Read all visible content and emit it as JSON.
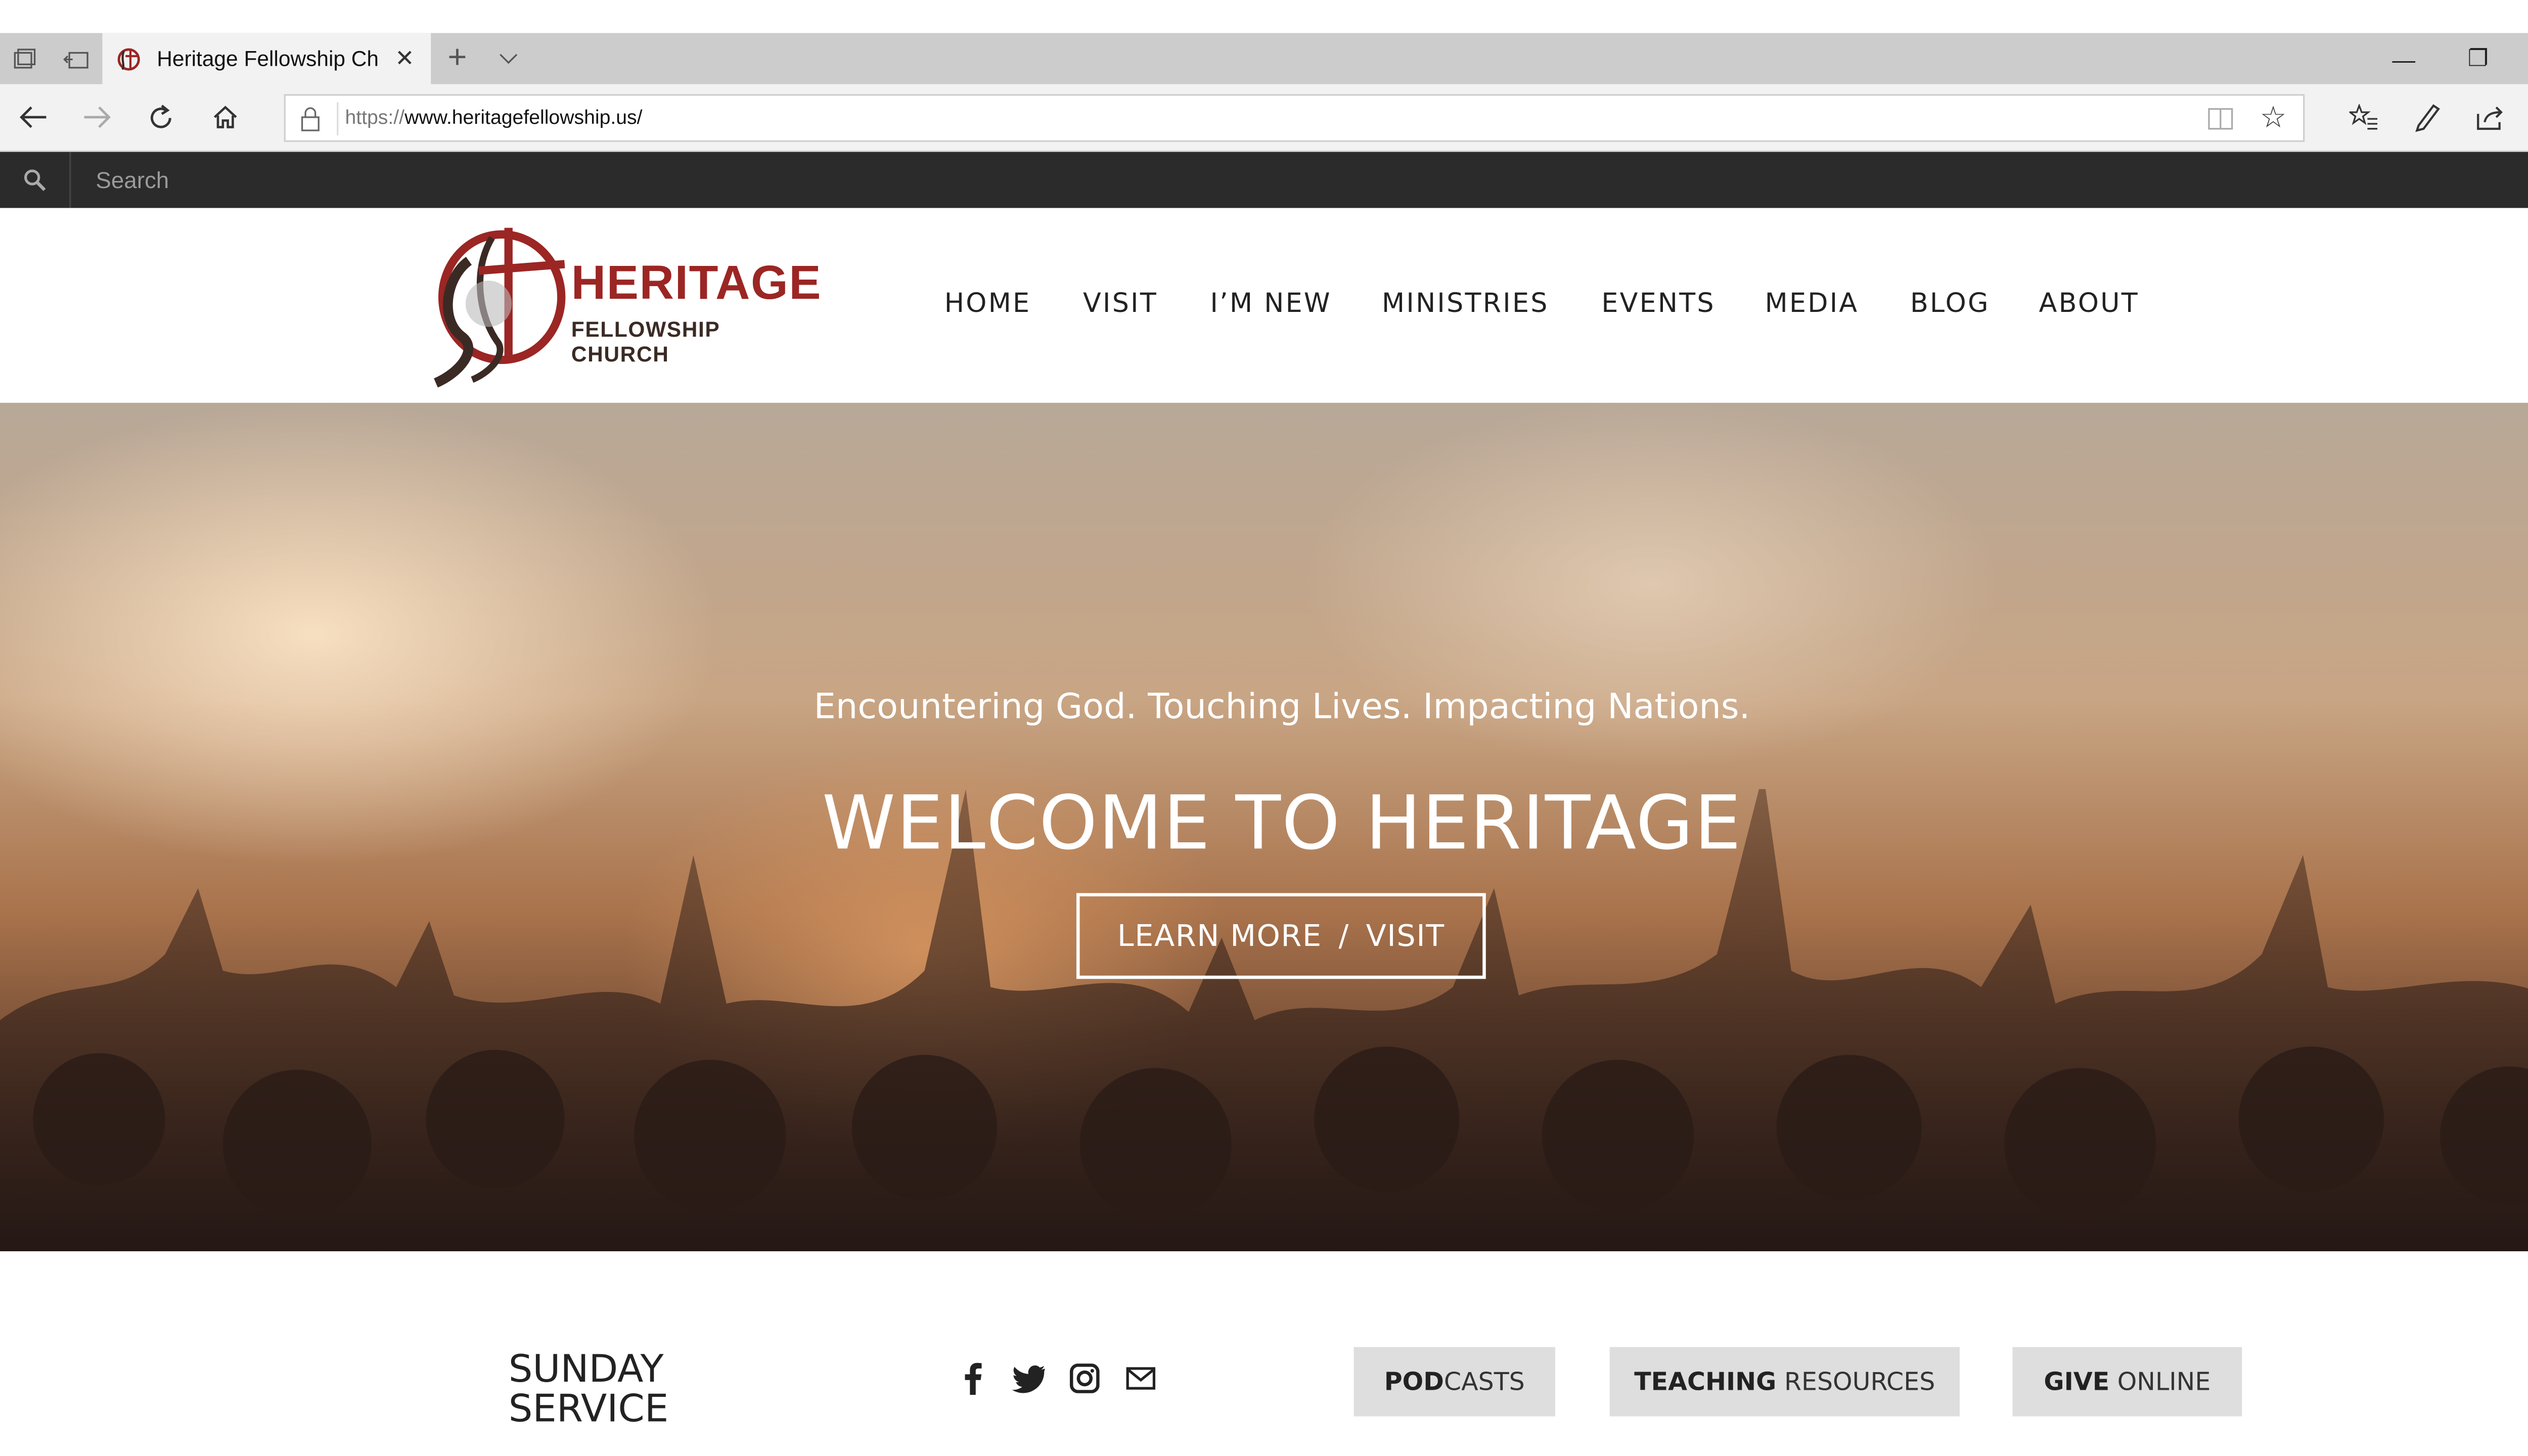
{
  "browser": {
    "tab_title": "Heritage Fellowship Chu",
    "url_prefix": "https://",
    "url_domain": "www.heritagefellowship.us/",
    "new_tab": "+",
    "tab_close": "✕",
    "min": "—",
    "restore": "❐",
    "close": "✕"
  },
  "search": {
    "placeholder": "Search"
  },
  "logo": {
    "name": "HERITAGE",
    "sub": "FELLOWSHIP CHURCH"
  },
  "nav": [
    {
      "label": "HOME"
    },
    {
      "label": "VISIT"
    },
    {
      "label": "I’M NEW"
    },
    {
      "label": "MINISTRIES"
    },
    {
      "label": "EVENTS"
    },
    {
      "label": "MEDIA"
    },
    {
      "label": "BLOG"
    },
    {
      "label": "ABOUT"
    }
  ],
  "hero": {
    "tagline": "Encountering God. Touching Lives. Impacting Nations.",
    "title": "WELCOME TO HERITAGE",
    "cta_left": "LEARN MORE",
    "cta_sep": "/",
    "cta_right": "VISIT"
  },
  "bottom": {
    "sunday_line1": "SUNDAY",
    "sunday_line2": "SERVICE",
    "pills": [
      {
        "bold": "POD",
        "rest": "CASTS"
      },
      {
        "bold": "TEACHING",
        "rest": " RESOURCES"
      },
      {
        "bold": "GIVE",
        "rest": " ONLINE"
      }
    ]
  },
  "colors": {
    "brand_red": "#9b2624",
    "search_bar": "#2b2b2b",
    "pill_bg": "#dedede"
  }
}
